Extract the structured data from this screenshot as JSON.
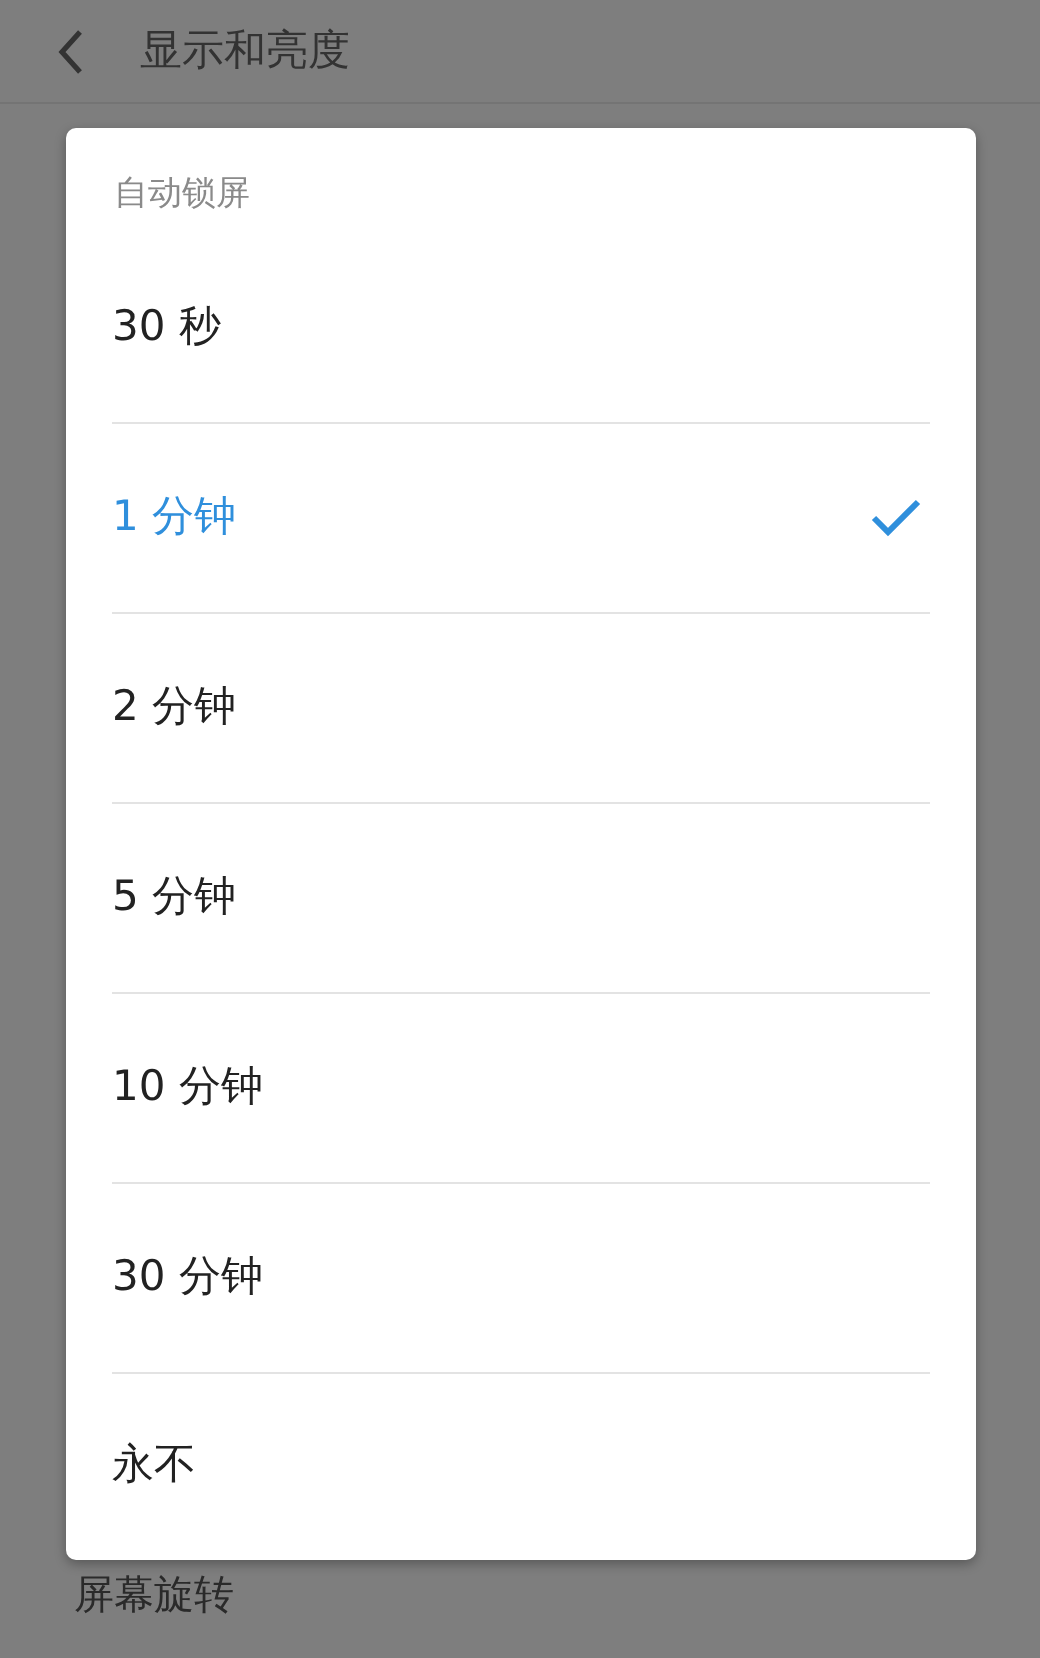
{
  "header": {
    "title": "显示和亮度"
  },
  "background_items": [
    {
      "label": "屏幕旋转"
    }
  ],
  "dialog": {
    "title": "自动锁屏",
    "options": [
      {
        "label": "30 秒",
        "selected": false
      },
      {
        "label": "1 分钟",
        "selected": true
      },
      {
        "label": "2 分钟",
        "selected": false
      },
      {
        "label": "5 分钟",
        "selected": false
      },
      {
        "label": "10 分钟",
        "selected": false
      },
      {
        "label": "30 分钟",
        "selected": false
      },
      {
        "label": "永不",
        "selected": false
      }
    ]
  }
}
